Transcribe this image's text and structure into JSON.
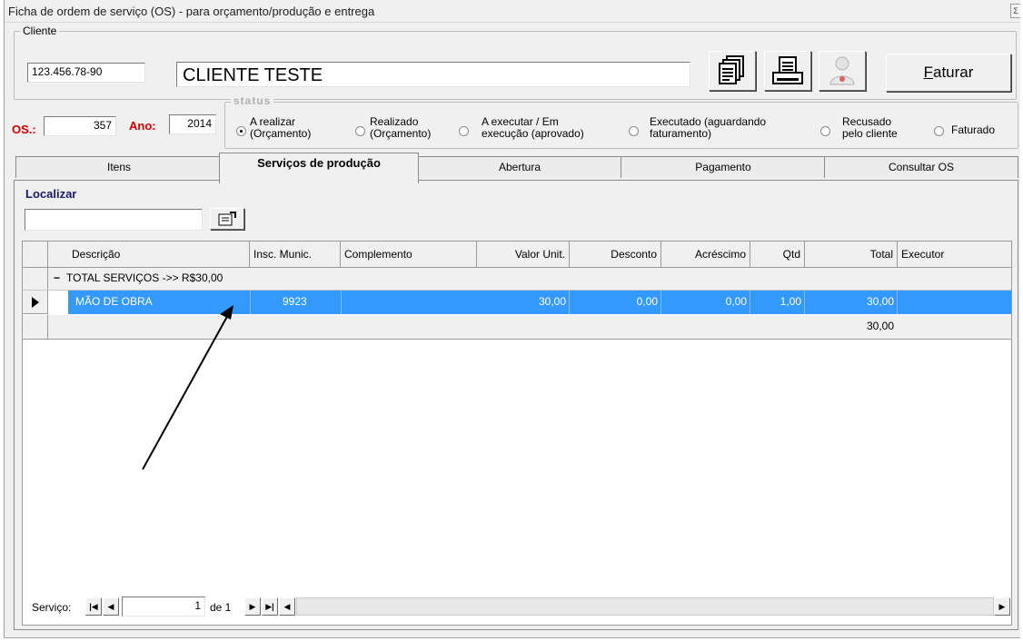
{
  "window": {
    "title": "Ficha de ordem de serviço (OS) - para orçamento/produção e entrega",
    "system_button": "Σ"
  },
  "cliente": {
    "legend": "Cliente",
    "code": "123.456.78-90",
    "name": "CLIENTE TESTE",
    "faturar_label_first": "F",
    "faturar_label_rest": "aturar"
  },
  "os": {
    "os_label": "OS.:",
    "os_value": "357",
    "ano_label": "Ano:",
    "ano_value": "2014"
  },
  "status": {
    "legend": "status",
    "options": [
      {
        "line1": "A realizar",
        "line2": "(Orçamento)"
      },
      {
        "line1": "Realizado",
        "line2": "(Orçamento)"
      },
      {
        "line1": "A executar / Em",
        "line2": "execução (aprovado)"
      },
      {
        "line1": "Executado (aguardando",
        "line2": "faturamento)"
      },
      {
        "line1": "Recusado",
        "line2": "pelo cliente"
      },
      {
        "line1": "Faturado",
        "line2": ""
      }
    ],
    "selected": "A realizar"
  },
  "tabs": [
    {
      "label": "Itens"
    },
    {
      "label": "Serviços de produção"
    },
    {
      "label": "Abertura"
    },
    {
      "label": "Pagamento"
    },
    {
      "label": "Consultar OS"
    }
  ],
  "localizar": {
    "label": "Localizar",
    "value": ""
  },
  "grid": {
    "columns": [
      "Descrição",
      "Insc. Munic.",
      "Complemento",
      "Valor Unit.",
      "Desconto",
      "Acréscimo",
      "Qtd",
      "Total",
      "Executor"
    ],
    "group_row": {
      "toggle": "−",
      "text": "TOTAL SERVIÇOS ->> R$30,00"
    },
    "rows": [
      {
        "descricao": "MÃO DE OBRA",
        "insc": "9923",
        "complemento": "",
        "valor": "30,00",
        "desconto": "0,00",
        "acrescimo": "0,00",
        "qtd": "1,00",
        "total": "30,00",
        "executor": ""
      }
    ],
    "footer_total": "30,00"
  },
  "navigator": {
    "label": "Serviço:",
    "record": "1",
    "of_text": "de 1"
  }
}
